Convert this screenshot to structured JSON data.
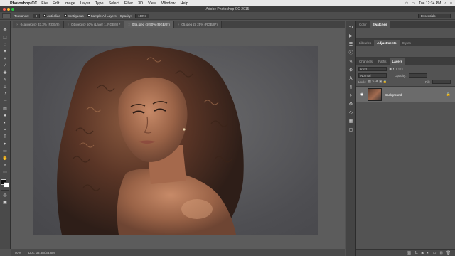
{
  "menubar": {
    "app_name": "Photoshop CC",
    "items": [
      "File",
      "Edit",
      "Image",
      "Layer",
      "Type",
      "Select",
      "Filter",
      "3D",
      "View",
      "Window",
      "Help"
    ],
    "clock": "Tue 12:34 PM"
  },
  "window": {
    "title": "Adobe Photoshop CC 2015"
  },
  "options": {
    "tolerance_label": "Tolerance:",
    "tolerance_value": "0",
    "antialias_label": "Anti-alias",
    "contiguous_label": "Contiguous",
    "sample_all_label": "Sample All Layers",
    "opacity_label": "Opacity:",
    "opacity_value": "100%",
    "workspace": "Essentials"
  },
  "tabs": [
    {
      "label": "04a.jpeg @ 33.3% (RGB/8)"
    },
    {
      "label": "04.jpeg @ 50% (Layer 1, RGB/8) *"
    },
    {
      "label": "04a.jpeg @ 50% (RGB/8*)"
    },
    {
      "label": "05.jpeg @ 25% (RGB/8*)"
    }
  ],
  "status": {
    "zoom": "50%",
    "doc": "Doc: 33.8M/33.8M"
  },
  "panels": {
    "top_tabs": [
      "Color",
      "Swatches"
    ],
    "mid_tabs": [
      "Libraries",
      "Adjustments",
      "Styles"
    ],
    "layer_tabs": [
      "Channels",
      "Paths",
      "Layers"
    ],
    "kind_label": "Kind",
    "blend_mode": "Normal",
    "opacity_label": "Opacity:",
    "lock_label": "Lock:",
    "fill_label": "Fill:",
    "layer_name": "Background"
  }
}
